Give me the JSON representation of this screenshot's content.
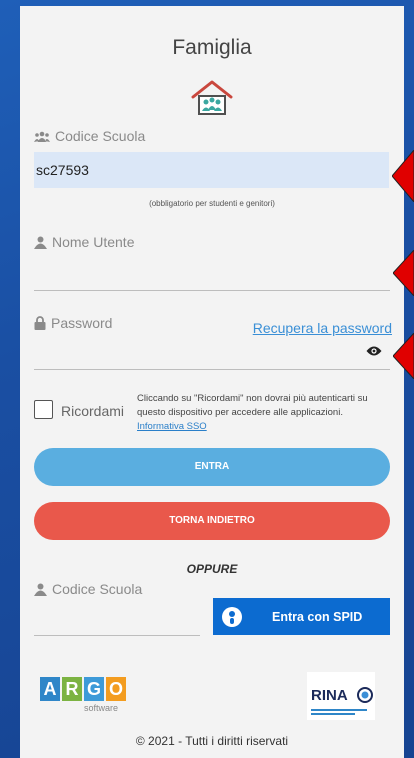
{
  "title": "Famiglia",
  "school_code": {
    "label": "Codice Scuola",
    "value": "sc27593",
    "hint": "(obbligatorio per studenti e genitori)"
  },
  "username": {
    "label": "Nome Utente",
    "value": ""
  },
  "password": {
    "label": "Password",
    "recover_link": "Recupera la password",
    "value": ""
  },
  "remember": {
    "label": "Ricordami",
    "note": "Cliccando su \"Ricordami\" non dovrai più autenticarti su questo dispositivo per accedere alle applicazioni.",
    "link": "Informativa SSO",
    "checked": false
  },
  "buttons": {
    "login": "ENTRA",
    "back": "TORNA INDIETRO",
    "spid": "Entra con SPID"
  },
  "oppure": "OPPURE",
  "spid_school_code": {
    "label": "Codice Scuola",
    "value": ""
  },
  "argo": {
    "letters": [
      "A",
      "R",
      "G",
      "O"
    ],
    "sub": "software"
  },
  "rina": {
    "text": "RINA"
  },
  "footer": "© 2021 - Tutti i diritti riservati",
  "colors": {
    "accent_blue": "#5aaee0",
    "back_red": "#e9584b",
    "spid_blue": "#0c6bd0",
    "arrow_red": "#e00000",
    "field_bg": "#dbe7f7"
  }
}
